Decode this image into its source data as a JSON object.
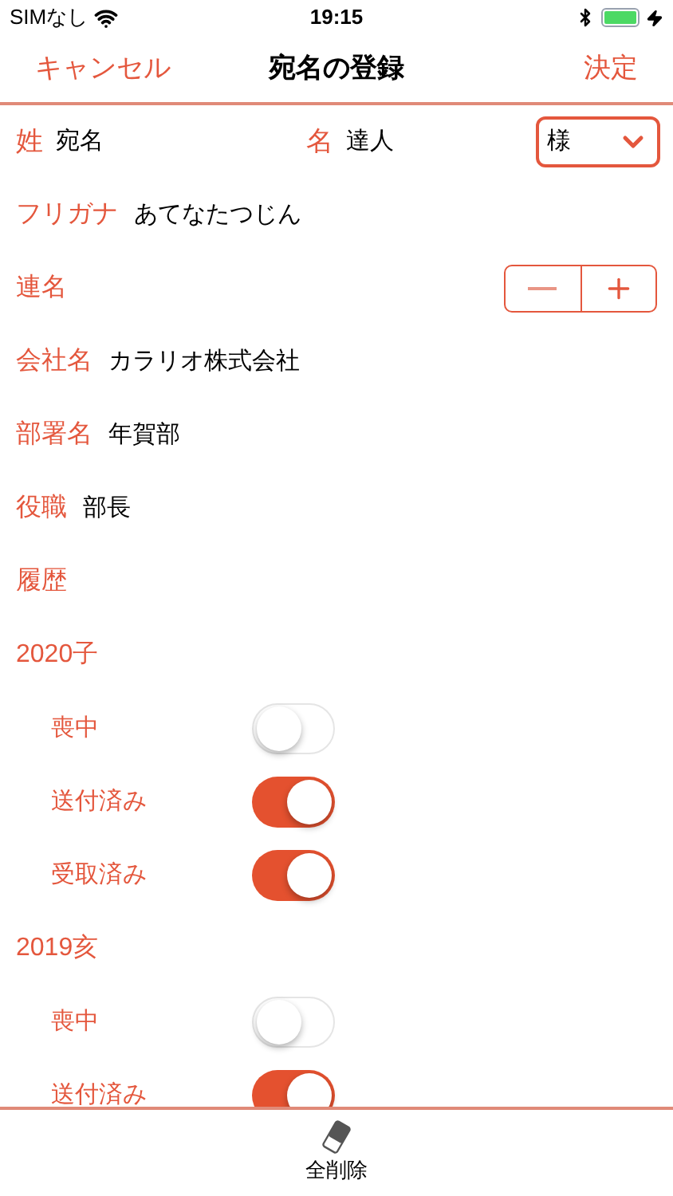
{
  "status_bar": {
    "carrier": "SIMなし",
    "time": "19:15"
  },
  "nav": {
    "cancel": "キャンセル",
    "title": "宛名の登録",
    "done": "決定"
  },
  "name_row": {
    "surname_label": "姓",
    "surname": "宛名",
    "given_label": "名",
    "given": "達人",
    "honorific": "様"
  },
  "fields": [
    {
      "kind": "text",
      "label": "フリガナ",
      "value": "あてなたつじん"
    },
    {
      "kind": "stepper",
      "label": "連名"
    },
    {
      "kind": "text",
      "label": "会社名",
      "value": "カラリオ株式会社"
    },
    {
      "kind": "text",
      "label": "部署名",
      "value": "年賀部"
    },
    {
      "kind": "text",
      "label": "役職",
      "value": "部長"
    }
  ],
  "history": {
    "label": "履歴",
    "years": [
      {
        "label": "2020子",
        "flags": [
          {
            "label": "喪中",
            "on": false
          },
          {
            "label": "送付済み",
            "on": true
          },
          {
            "label": "受取済み",
            "on": true
          }
        ]
      },
      {
        "label": "2019亥",
        "flags": [
          {
            "label": "喪中",
            "on": false
          },
          {
            "label": "送付済み",
            "on": true
          }
        ]
      }
    ]
  },
  "toolbar": {
    "delete_all": "全削除"
  }
}
